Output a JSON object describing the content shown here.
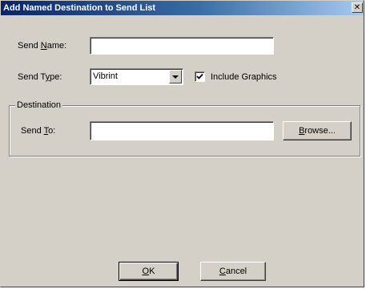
{
  "dialog": {
    "title": "Add Named Destination to Send List",
    "close_glyph": "✕"
  },
  "send_name": {
    "label_pre": "Send ",
    "label_ul": "N",
    "label_post": "ame:",
    "value": ""
  },
  "send_type": {
    "label_pre": "Send T",
    "label_ul": "y",
    "label_post": "pe:",
    "selected": "Vibrint"
  },
  "include_graphics": {
    "label": "Include Graphics",
    "checked": true
  },
  "destination": {
    "group_label": "Destination",
    "send_to_pre": "Send ",
    "send_to_ul": "T",
    "send_to_post": "o:",
    "send_to_value": "",
    "browse_ul": "B",
    "browse_rest": "rowse..."
  },
  "buttons": {
    "ok_ul": "O",
    "ok_rest": "K",
    "cancel_ul": "C",
    "cancel_rest": "ancel"
  }
}
